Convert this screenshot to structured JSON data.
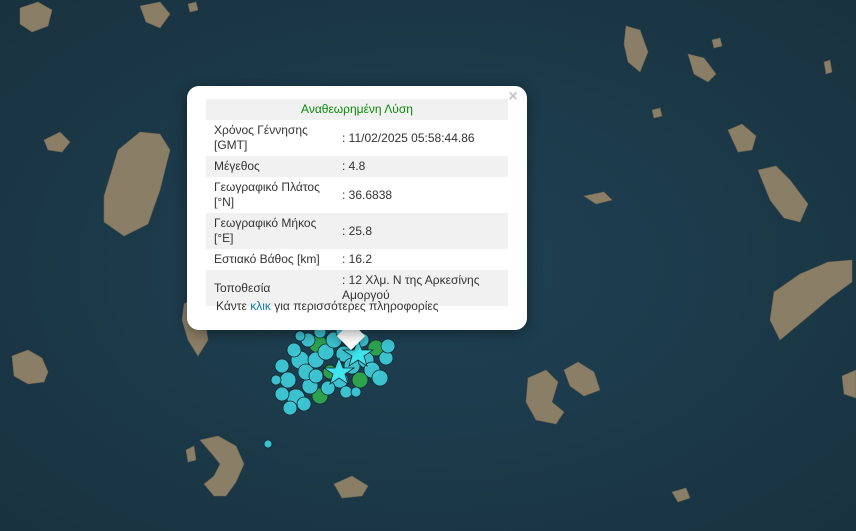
{
  "popup": {
    "title": "Αναθεωρημένη Λύση",
    "rows": [
      {
        "label": "Χρόνος Γέννησης [GMT]",
        "value": ": 11/02/2025 05:58:44.86"
      },
      {
        "label": "Μέγεθος",
        "value": ": 4.8"
      },
      {
        "label": "Γεωγραφικό Πλάτος [°N]",
        "value": ": 36.6838"
      },
      {
        "label": "Γεωγραφικό Μήκος [°E]",
        "value": ": 25.8"
      },
      {
        "label": "Εστιακό Βάθος [km]",
        "value": ": 16.2"
      },
      {
        "label": "Τοποθεσία",
        "value": ": 12 Χλμ. Ν της Αρκεσίνης Αμοργού"
      }
    ],
    "more_prefix": "Κάντε",
    "more_link": "κλικ",
    "more_suffix": "για περισσότερες πληροφορίες",
    "close_symbol": "×"
  },
  "map": {
    "sea_color": "#1d3a4c",
    "land_color": "#8c8069",
    "cyan_marker_color": "#3ec8d6",
    "green_marker_color": "#2ea84e",
    "star_color": "#3fe4ec"
  }
}
